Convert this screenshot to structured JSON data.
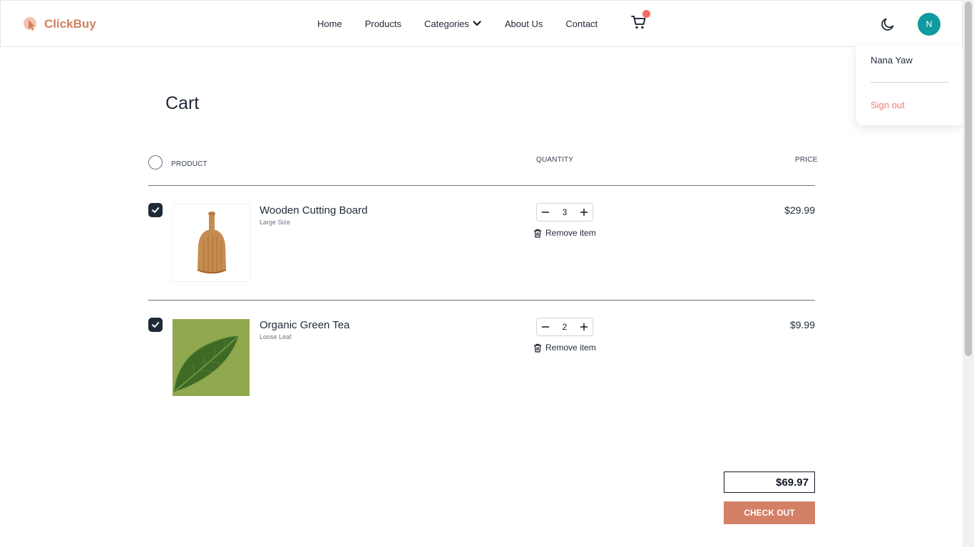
{
  "brand": {
    "name": "ClickBuy",
    "accent": "#d0805f"
  },
  "nav": {
    "links": [
      "Home",
      "Products",
      "Categories",
      "About Us",
      "Contact"
    ],
    "categories_chevron_icon": "chevron-down-icon",
    "cart_icon": "cart-icon",
    "cart_badge_color": "#f26a64",
    "theme_icon": "moon-icon"
  },
  "user": {
    "initial": "N",
    "avatar_color": "#0f9a9f",
    "name": "Nana Yaw",
    "sign_out_label": "Sign out"
  },
  "cart": {
    "title": "Cart",
    "columns": {
      "product": "PRODUCT",
      "quantity": "QUANTITY",
      "price": "PRICE"
    },
    "items": [
      {
        "name": "Wooden Cutting Board",
        "variant": "Large Size",
        "quantity": "3",
        "remove_label": "Remove item",
        "price": "$29.99",
        "checked": true
      },
      {
        "name": "Organic Green Tea",
        "variant": "Loose Leaf",
        "quantity": "2",
        "remove_label": "Remove item",
        "price": "$9.99",
        "checked": true
      }
    ],
    "total": "$69.97",
    "checkout_label": "CHECK OUT"
  }
}
